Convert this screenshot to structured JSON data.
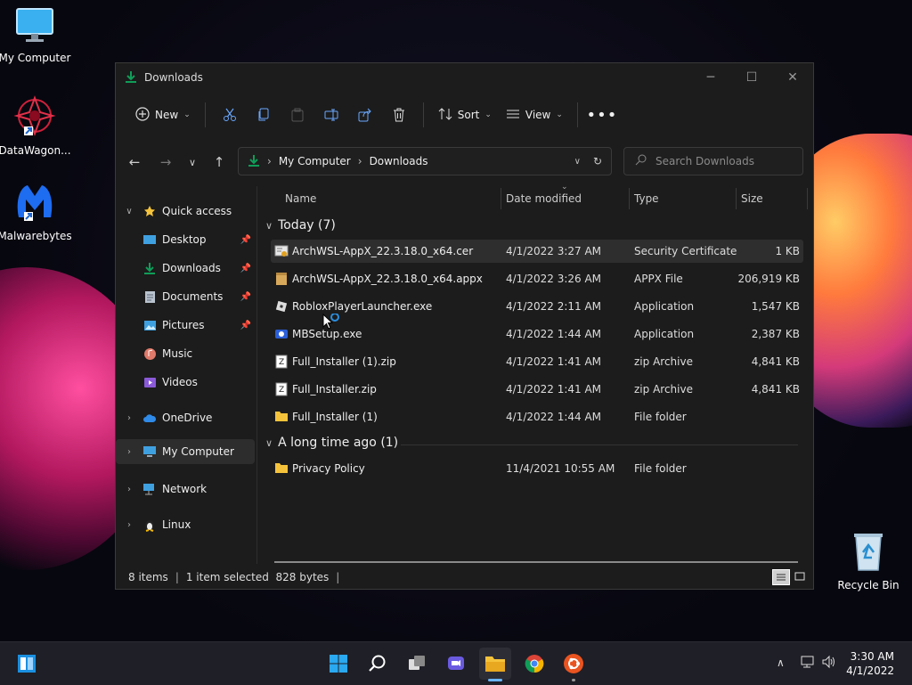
{
  "desktop": {
    "icons": [
      {
        "label": "My Computer",
        "icon": "monitor-icon"
      },
      {
        "label": "DataWagon...",
        "icon": "datawagon-icon"
      },
      {
        "label": "Malwarebytes",
        "icon": "malwarebytes-icon"
      },
      {
        "label": "Recycle Bin",
        "icon": "recycle-bin-icon"
      }
    ]
  },
  "window": {
    "title": "Downloads",
    "controls": [
      "minimize",
      "maximize",
      "close"
    ]
  },
  "toolbar": {
    "new_label": "New",
    "sort_label": "Sort",
    "view_label": "View",
    "icons": [
      "cut-icon",
      "copy-icon",
      "paste-icon",
      "rename-icon",
      "share-icon",
      "delete-icon",
      "more-icon"
    ]
  },
  "address": {
    "crumbs": [
      "My Computer",
      "Downloads"
    ]
  },
  "search": {
    "placeholder": "Search Downloads"
  },
  "nav": {
    "quick_access": "Quick access",
    "items": [
      {
        "label": "Desktop",
        "pinned": true
      },
      {
        "label": "Downloads",
        "pinned": true
      },
      {
        "label": "Documents",
        "pinned": true
      },
      {
        "label": "Pictures",
        "pinned": true
      },
      {
        "label": "Music",
        "pinned": false
      },
      {
        "label": "Videos",
        "pinned": false
      }
    ],
    "roots": [
      {
        "label": "OneDrive"
      },
      {
        "label": "My Computer",
        "selected": true
      },
      {
        "label": "Network"
      },
      {
        "label": "Linux"
      }
    ]
  },
  "columns": {
    "name": "Name",
    "date": "Date modified",
    "type": "Type",
    "size": "Size"
  },
  "groups": [
    {
      "title": "Today (7)",
      "files": [
        {
          "name": "ArchWSL-AppX_22.3.18.0_x64.cer",
          "date": "4/1/2022 3:27 AM",
          "type": "Security Certificate",
          "size": "1 KB",
          "icon": "certificate-icon",
          "selected": true
        },
        {
          "name": "ArchWSL-AppX_22.3.18.0_x64.appx",
          "date": "4/1/2022 3:26 AM",
          "type": "APPX File",
          "size": "206,919 KB",
          "icon": "package-icon"
        },
        {
          "name": "RobloxPlayerLauncher.exe",
          "date": "4/1/2022 2:11 AM",
          "type": "Application",
          "size": "1,547 KB",
          "icon": "roblox-icon"
        },
        {
          "name": "MBSetup.exe",
          "date": "4/1/2022 1:44 AM",
          "type": "Application",
          "size": "2,387 KB",
          "icon": "mbsetup-icon"
        },
        {
          "name": "Full_Installer (1).zip",
          "date": "4/1/2022 1:41 AM",
          "type": "zip Archive",
          "size": "4,841 KB",
          "icon": "zip-icon"
        },
        {
          "name": "Full_Installer.zip",
          "date": "4/1/2022 1:41 AM",
          "type": "zip Archive",
          "size": "4,841 KB",
          "icon": "zip-icon"
        },
        {
          "name": "Full_Installer (1)",
          "date": "4/1/2022 1:44 AM",
          "type": "File folder",
          "size": "",
          "icon": "folder-icon"
        }
      ]
    },
    {
      "title": "A long time ago (1)",
      "files": [
        {
          "name": "Privacy Policy",
          "date": "11/4/2021 10:55 AM",
          "type": "File folder",
          "size": "",
          "icon": "folder-icon"
        }
      ]
    }
  ],
  "status": {
    "items": "8 items",
    "selection": "1 item selected  828 bytes"
  },
  "taskbar": {
    "apps": [
      "windows-start-icon",
      "search-icon",
      "task-view-icon",
      "chat-icon",
      "file-explorer-icon",
      "chrome-icon",
      "ubuntu-icon"
    ],
    "time": "3:30 AM",
    "date": "4/1/2022"
  },
  "colors": {
    "accent": "#0f9d58",
    "folder": "#f5c33b",
    "selection": "#2e2e2e"
  }
}
